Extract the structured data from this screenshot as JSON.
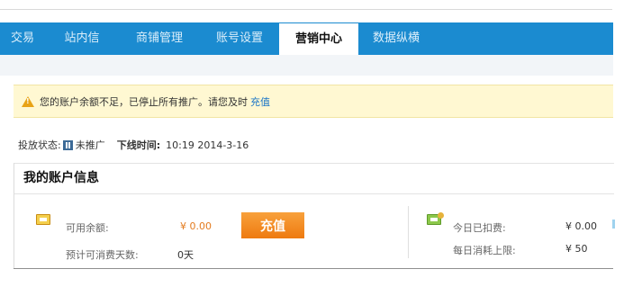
{
  "nav": {
    "items": [
      {
        "label": "交易",
        "active": false
      },
      {
        "label": "站内信",
        "active": false
      },
      {
        "label": "商铺管理",
        "active": false
      },
      {
        "label": "账号设置",
        "active": false
      },
      {
        "label": "营销中心",
        "active": true
      },
      {
        "label": "数据纵横",
        "active": false
      }
    ]
  },
  "alert": {
    "icon": "warning-icon",
    "message": "您的账户余额不足，已停止所有推广。请您及时",
    "link": "充值"
  },
  "status": {
    "label": "投放状态:",
    "value": "未推广",
    "offline_label": "下线时间:",
    "offline_time": "10:19 2014-3-16"
  },
  "account": {
    "title": "我的账户信息",
    "available_label": "可用余额:",
    "available_value": "¥ 0.00",
    "recharge_button": "充值",
    "days_label": "预计可消费天数:",
    "days_value": "0天",
    "today_label": "今日已扣费:",
    "today_value": "¥ 0.00",
    "limit_label": "每日消耗上限:",
    "limit_value": "¥ 50"
  },
  "colors": {
    "nav_bg": "#1b8bd0",
    "alert_bg": "#fff8d2",
    "button": "#f08a1c",
    "link": "#1a75c7"
  }
}
